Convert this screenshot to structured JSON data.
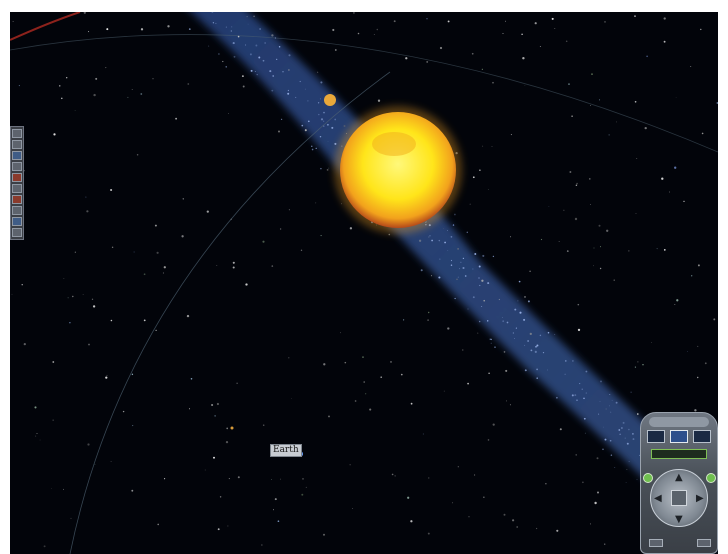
{
  "scene": {
    "earth_label": "Earth"
  },
  "colors": {
    "space": "#02040a",
    "milky_way": "#3d5fa8",
    "sun_core": "#fff43a",
    "sun_rim": "#e07a1a",
    "orbit_line": "#5a6b7a"
  },
  "icons": {
    "toolbar": [
      "close-icon",
      "settings-icon",
      "star-icon",
      "zoom-icon",
      "grid-icon",
      "camera-icon",
      "planet-icon",
      "help-icon",
      "time-icon",
      "menu-icon"
    ],
    "navigation": [
      "up-arrow-icon",
      "down-arrow-icon",
      "left-arrow-icon",
      "right-arrow-icon"
    ]
  }
}
